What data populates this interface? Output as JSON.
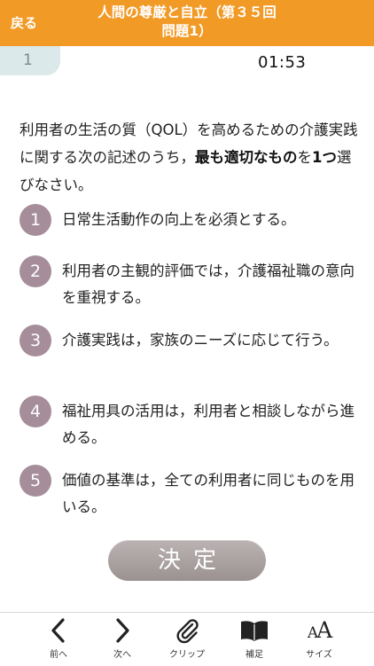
{
  "header": {
    "back_label": "戻る",
    "title_line1": "人間の尊厳と自立（第３５回",
    "title_line2": "問題1）",
    "background_color": "#f29a26"
  },
  "question_number": "1",
  "timer": "01:53",
  "question": {
    "text_before": "利用者の生活の質（QOL）を高めるための介護実践に関する次の記述のうち，",
    "emphasis1": "最も適切なもの",
    "text_middle": "を",
    "emphasis2": "1つ",
    "text_after": "選びなさい。"
  },
  "options": [
    {
      "number": "1",
      "text": "日常生活動作の向上を必須とする。"
    },
    {
      "number": "2",
      "text": "利用者の主観的評価では，介護福祉職の意向を重視する。"
    },
    {
      "number": "3",
      "text": "介護実践は，家族のニーズに応じて行う。"
    },
    {
      "number": "4",
      "text": "福祉用具の活用は，利用者と相談しながら進める。"
    },
    {
      "number": "5",
      "text": "価値の基準は，全ての利用者に同じものを用いる。"
    }
  ],
  "option_color": "#a58d9a",
  "decide_button": "決定",
  "toolbar": {
    "prev": {
      "label": "前へ",
      "icon": "chevron-left-icon"
    },
    "next": {
      "label": "次へ",
      "icon": "chevron-right-icon"
    },
    "clip": {
      "label": "クリップ",
      "icon": "paperclip-icon"
    },
    "supplement": {
      "label": "補足",
      "icon": "open-book-icon"
    },
    "size": {
      "label": "サイズ",
      "icon": "text-size-icon",
      "icon_text_large": "A",
      "icon_text_small": "A"
    }
  }
}
